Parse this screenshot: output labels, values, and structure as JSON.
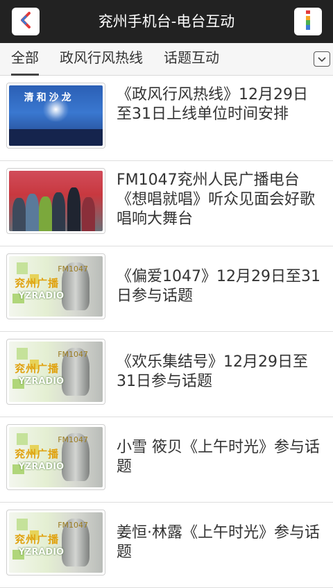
{
  "header": {
    "title": "兖州手机台-电台互动",
    "back_icon": "chevron-left-icon",
    "info_icon": "info-icon",
    "accent_colors": [
      "#e23b3b",
      "#f5a623",
      "#3a7bd5"
    ]
  },
  "tabs": [
    {
      "label": "全部",
      "active": true
    },
    {
      "label": "政风行风热线",
      "active": false
    },
    {
      "label": "话题互动",
      "active": false
    }
  ],
  "tab_menu_icon": "chevron-down-icon",
  "items": [
    {
      "title": "《政风行风热线》12月29日至31日上线单位时间安排",
      "thumb": "stage-photo"
    },
    {
      "title": "FM1047兖州人民广播电台《想唱就唱》听众见面会好歌唱响大舞台",
      "thumb": "crowd-photo"
    },
    {
      "title": "《偏爱1047》12月29日至31日参与话题",
      "thumb": "radio-logo"
    },
    {
      "title": "《欢乐集结号》12月29日至31日参与话题",
      "thumb": "radio-logo"
    },
    {
      "title": "小雪 筱贝《上午时光》参与话题",
      "thumb": "radio-logo"
    },
    {
      "title": "姜恒·林露《上午时光》参与话题",
      "thumb": "radio-logo"
    }
  ],
  "stage_logo_text": "清和沙龙",
  "radio_logo": {
    "name": "兖州广播",
    "sub": "YZRADIO",
    "fm": "FM1047"
  }
}
